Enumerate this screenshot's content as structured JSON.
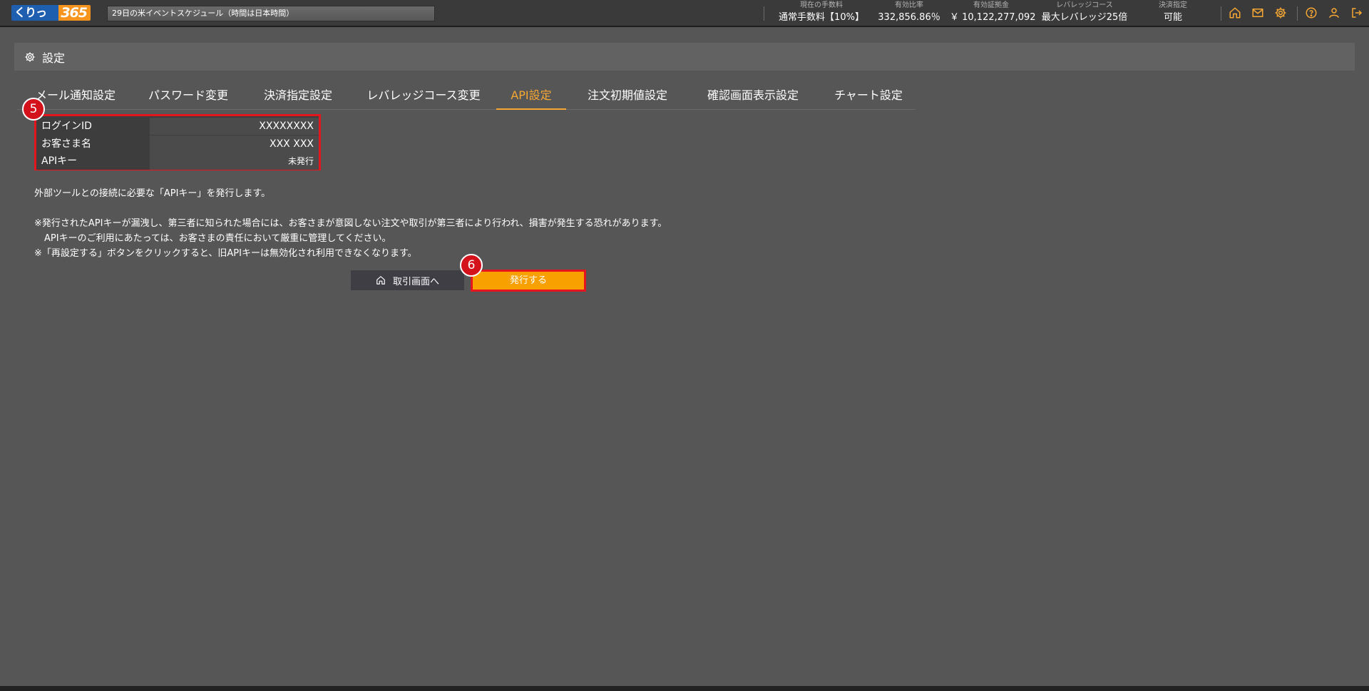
{
  "header": {
    "logo": {
      "part1": "くりっく",
      "part2": "365"
    },
    "ticker_text": "29日の米イベントスケジュール（時間は日本時間）",
    "stats": [
      {
        "label": "現在の手数料",
        "value": "通常手数料【10%】"
      },
      {
        "label": "有効比率",
        "value": "332,856.86％"
      },
      {
        "label": "有効証拠金",
        "value": "￥ 10,122,277,092"
      },
      {
        "label": "レバレッジコース",
        "value": "最大レバレッジ25倍"
      },
      {
        "label": "決済指定",
        "value": "可能"
      }
    ],
    "icons": [
      "home-icon",
      "mail-icon",
      "gear-icon",
      "help-icon",
      "user-icon",
      "logout-icon"
    ],
    "accent_color": "#f7a733"
  },
  "titlebar": {
    "title": "設定"
  },
  "tabs": [
    {
      "label": "メール通知設定",
      "active": false
    },
    {
      "label": "パスワード変更",
      "active": false
    },
    {
      "label": "決済指定設定",
      "active": false
    },
    {
      "label": "レバレッジコース変更",
      "active": false
    },
    {
      "label": "API設定",
      "active": true
    },
    {
      "label": "注文初期値設定",
      "active": false
    },
    {
      "label": "確認画面表示設定",
      "active": false
    },
    {
      "label": "チャート設定",
      "active": false
    }
  ],
  "info": {
    "rows": [
      {
        "label": "ログインID",
        "value": "XXXXXXXX"
      },
      {
        "label": "お客さま名",
        "value": "XXX XXX"
      },
      {
        "label": "APIキー",
        "value": "未発行"
      }
    ]
  },
  "badges": {
    "b5": "5",
    "b6": "6"
  },
  "description": {
    "line1": "外部ツールとの接続に必要な「APIキー」を発行します。",
    "line2": "※発行されたAPIキーが漏洩し、第三者に知られた場合には、お客さまが意図しない注文や取引が第三者により行われ、損害が発生する恐れがあります。",
    "line3": "APIキーのご利用にあたっては、お客さまの責任において厳重に管理してください。",
    "line4": "※「再設定する」ボタンをクリックすると、旧APIキーは無効化され利用できなくなります。"
  },
  "buttons": {
    "home": "取引画面へ",
    "issue": "発行する"
  },
  "colors": {
    "highlight_border": "#e4151f",
    "issue_button": "#f7a000",
    "background": "#565656"
  }
}
